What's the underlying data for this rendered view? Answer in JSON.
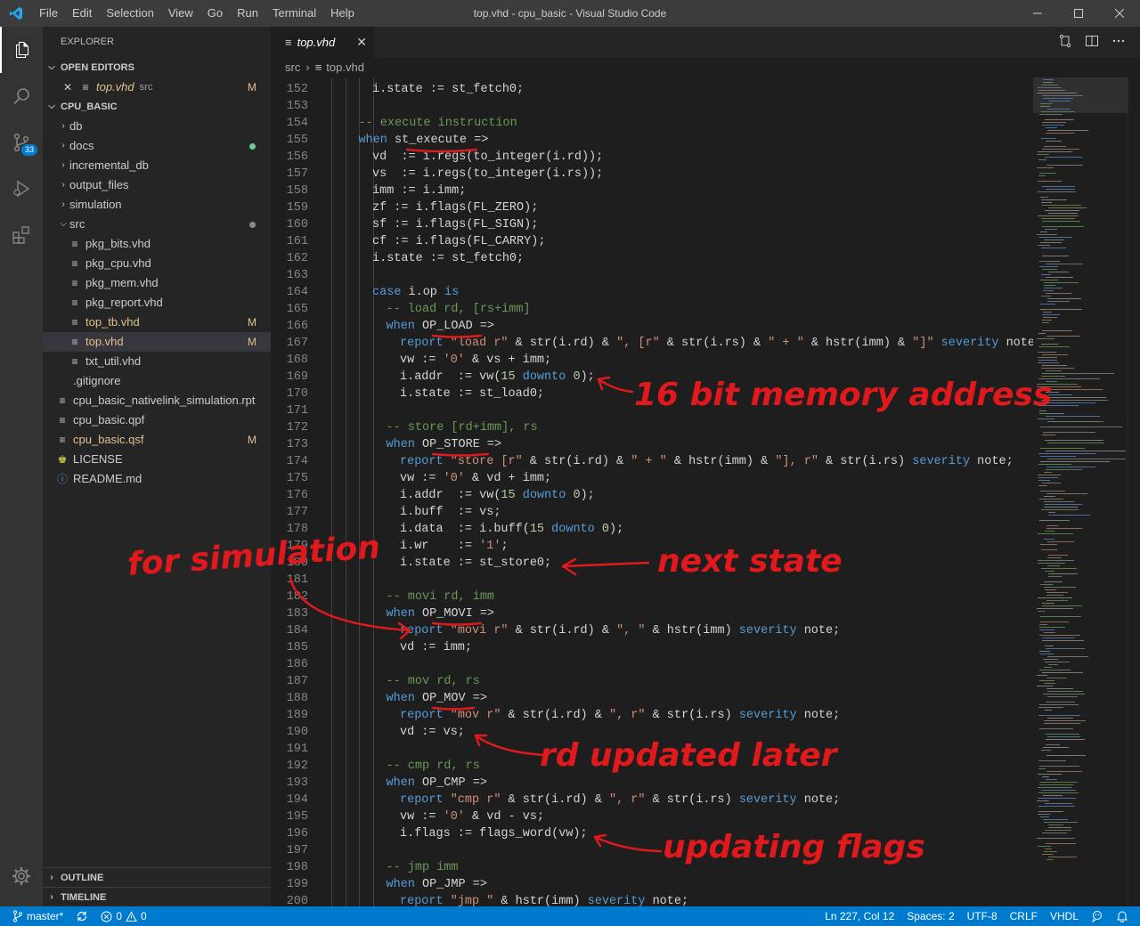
{
  "window": {
    "title": "top.vhd - cpu_basic - Visual Studio Code"
  },
  "menu": [
    "File",
    "Edit",
    "Selection",
    "View",
    "Go",
    "Run",
    "Terminal",
    "Help"
  ],
  "activity": {
    "scm_badge": "33"
  },
  "sidebar": {
    "header": "EXPLORER",
    "open_editors": {
      "title": "OPEN EDITORS",
      "items": [
        {
          "name": "top.vhd",
          "folder": "src",
          "status": "M"
        }
      ]
    },
    "project": {
      "title": "CPU_BASIC",
      "folders": [
        "db",
        "docs",
        "incremental_db",
        "output_files",
        "simulation",
        "src"
      ],
      "src_files": [
        {
          "name": "pkg_bits.vhd",
          "status": ""
        },
        {
          "name": "pkg_cpu.vhd",
          "status": ""
        },
        {
          "name": "pkg_mem.vhd",
          "status": ""
        },
        {
          "name": "pkg_report.vhd",
          "status": ""
        },
        {
          "name": "top_tb.vhd",
          "status": "M"
        },
        {
          "name": "top.vhd",
          "status": "M"
        },
        {
          "name": "txt_util.vhd",
          "status": ""
        }
      ],
      "root_files": [
        {
          "name": ".gitignore",
          "status": ""
        },
        {
          "name": "cpu_basic_nativelink_simulation.rpt",
          "status": ""
        },
        {
          "name": "cpu_basic.qpf",
          "status": ""
        },
        {
          "name": "cpu_basic.qsf",
          "status": "M"
        },
        {
          "name": "LICENSE",
          "status": ""
        },
        {
          "name": "README.md",
          "status": ""
        }
      ]
    },
    "outline": "OUTLINE",
    "timeline": "TIMELINE"
  },
  "editor": {
    "tab": "top.vhd",
    "breadcrumb": [
      "src",
      "top.vhd"
    ],
    "lines": [
      {
        "n": "152",
        "i": 2,
        "t": [
          [
            "",
            "i.state := st_fetch0;"
          ]
        ]
      },
      {
        "n": "153",
        "i": 0,
        "t": []
      },
      {
        "n": "154",
        "i": 1,
        "t": [
          [
            "c",
            "-- execute instruction"
          ]
        ]
      },
      {
        "n": "155",
        "i": 1,
        "t": [
          [
            "k",
            "when"
          ],
          [
            "",
            " st_execute =>"
          ]
        ]
      },
      {
        "n": "156",
        "i": 2,
        "t": [
          [
            "",
            "vd  := i.regs(to_integer(i.rd));"
          ]
        ]
      },
      {
        "n": "157",
        "i": 2,
        "t": [
          [
            "",
            "vs  := i.regs(to_integer(i.rs));"
          ]
        ]
      },
      {
        "n": "158",
        "i": 2,
        "t": [
          [
            "",
            "imm := i.imm;"
          ]
        ]
      },
      {
        "n": "159",
        "i": 2,
        "t": [
          [
            "",
            "zf := i.flags(FL_ZERO);"
          ]
        ]
      },
      {
        "n": "160",
        "i": 2,
        "t": [
          [
            "",
            "sf := i.flags(FL_SIGN);"
          ]
        ]
      },
      {
        "n": "161",
        "i": 2,
        "t": [
          [
            "",
            "cf := i.flags(FL_CARRY);"
          ]
        ]
      },
      {
        "n": "162",
        "i": 2,
        "t": [
          [
            "",
            "i.state := st_fetch0;"
          ]
        ]
      },
      {
        "n": "163",
        "i": 0,
        "t": []
      },
      {
        "n": "164",
        "i": 2,
        "t": [
          [
            "k",
            "case"
          ],
          [
            "",
            " i.op "
          ],
          [
            "k",
            "is"
          ]
        ]
      },
      {
        "n": "165",
        "i": 3,
        "t": [
          [
            "c",
            "-- load rd, [rs+imm]"
          ]
        ]
      },
      {
        "n": "166",
        "i": 3,
        "t": [
          [
            "k",
            "when"
          ],
          [
            "",
            " OP_LOAD =>"
          ]
        ]
      },
      {
        "n": "167",
        "i": 4,
        "t": [
          [
            "k",
            "report"
          ],
          [
            "",
            " "
          ],
          [
            "s",
            "\"load r\""
          ],
          [
            "",
            " & str(i.rd) & "
          ],
          [
            "s",
            "\", [r\""
          ],
          [
            "",
            " & str(i.rs) & "
          ],
          [
            "s",
            "\" + \""
          ],
          [
            "",
            " & hstr(imm) & "
          ],
          [
            "s",
            "\"]\""
          ],
          [
            "",
            " "
          ],
          [
            "k",
            "severity"
          ],
          [
            "",
            " note;"
          ]
        ]
      },
      {
        "n": "168",
        "i": 4,
        "t": [
          [
            "",
            "vw := "
          ],
          [
            "s",
            "'0'"
          ],
          [
            "",
            " & vs + imm;"
          ]
        ]
      },
      {
        "n": "169",
        "i": 4,
        "t": [
          [
            "",
            "i.addr  := vw("
          ],
          [
            "n",
            "15"
          ],
          [
            "",
            " "
          ],
          [
            "k",
            "downto"
          ],
          [
            "",
            " "
          ],
          [
            "n",
            "0"
          ],
          [
            "",
            ");"
          ]
        ]
      },
      {
        "n": "170",
        "i": 4,
        "t": [
          [
            "",
            "i.state := st_load0;"
          ]
        ]
      },
      {
        "n": "171",
        "i": 0,
        "t": []
      },
      {
        "n": "172",
        "i": 3,
        "t": [
          [
            "c",
            "-- store [rd+imm], rs"
          ]
        ]
      },
      {
        "n": "173",
        "i": 3,
        "t": [
          [
            "k",
            "when"
          ],
          [
            "",
            " OP_STORE =>"
          ]
        ]
      },
      {
        "n": "174",
        "i": 4,
        "t": [
          [
            "k",
            "report"
          ],
          [
            "",
            " "
          ],
          [
            "s",
            "\"store [r\""
          ],
          [
            "",
            " & str(i.rd) & "
          ],
          [
            "s",
            "\" + \""
          ],
          [
            "",
            " & hstr(imm) & "
          ],
          [
            "s",
            "\"], r\""
          ],
          [
            "",
            " & str(i.rs) "
          ],
          [
            "k",
            "severity"
          ],
          [
            "",
            " note;"
          ]
        ]
      },
      {
        "n": "175",
        "i": 4,
        "t": [
          [
            "",
            "vw := "
          ],
          [
            "s",
            "'0'"
          ],
          [
            "",
            " & vd + imm;"
          ]
        ]
      },
      {
        "n": "176",
        "i": 4,
        "t": [
          [
            "",
            "i.addr  := vw("
          ],
          [
            "n",
            "15"
          ],
          [
            "",
            " "
          ],
          [
            "k",
            "downto"
          ],
          [
            "",
            " "
          ],
          [
            "n",
            "0"
          ],
          [
            "",
            ");"
          ]
        ]
      },
      {
        "n": "177",
        "i": 4,
        "t": [
          [
            "",
            "i.buff  := vs;"
          ]
        ]
      },
      {
        "n": "178",
        "i": 4,
        "t": [
          [
            "",
            "i.data  := i.buff("
          ],
          [
            "n",
            "15"
          ],
          [
            "",
            " "
          ],
          [
            "k",
            "downto"
          ],
          [
            "",
            " "
          ],
          [
            "n",
            "0"
          ],
          [
            "",
            ");"
          ]
        ]
      },
      {
        "n": "179",
        "i": 4,
        "t": [
          [
            "",
            "i.wr    := "
          ],
          [
            "s",
            "'1'"
          ],
          [
            "",
            ";"
          ]
        ]
      },
      {
        "n": "180",
        "i": 4,
        "t": [
          [
            "",
            "i.state := st_store0;"
          ]
        ]
      },
      {
        "n": "181",
        "i": 0,
        "t": []
      },
      {
        "n": "182",
        "i": 3,
        "t": [
          [
            "c",
            "-- movi rd, imm"
          ]
        ]
      },
      {
        "n": "183",
        "i": 3,
        "t": [
          [
            "k",
            "when"
          ],
          [
            "",
            " OP_MOVI =>"
          ]
        ]
      },
      {
        "n": "184",
        "i": 4,
        "t": [
          [
            "k",
            "report"
          ],
          [
            "",
            " "
          ],
          [
            "s",
            "\"movi r\""
          ],
          [
            "",
            " & str(i.rd) & "
          ],
          [
            "s",
            "\", \""
          ],
          [
            "",
            " & hstr(imm) "
          ],
          [
            "k",
            "severity"
          ],
          [
            "",
            " note;"
          ]
        ]
      },
      {
        "n": "185",
        "i": 4,
        "t": [
          [
            "",
            "vd := imm;"
          ]
        ]
      },
      {
        "n": "186",
        "i": 0,
        "t": []
      },
      {
        "n": "187",
        "i": 3,
        "t": [
          [
            "c",
            "-- mov rd, rs"
          ]
        ]
      },
      {
        "n": "188",
        "i": 3,
        "t": [
          [
            "k",
            "when"
          ],
          [
            "",
            " OP_MOV =>"
          ]
        ]
      },
      {
        "n": "189",
        "i": 4,
        "t": [
          [
            "k",
            "report"
          ],
          [
            "",
            " "
          ],
          [
            "s",
            "\"mov r\""
          ],
          [
            "",
            " & str(i.rd) & "
          ],
          [
            "s",
            "\", r\""
          ],
          [
            "",
            " & str(i.rs) "
          ],
          [
            "k",
            "severity"
          ],
          [
            "",
            " note;"
          ]
        ]
      },
      {
        "n": "190",
        "i": 4,
        "t": [
          [
            "",
            "vd := vs;"
          ]
        ]
      },
      {
        "n": "191",
        "i": 0,
        "t": []
      },
      {
        "n": "192",
        "i": 3,
        "t": [
          [
            "c",
            "-- cmp rd, rs"
          ]
        ]
      },
      {
        "n": "193",
        "i": 3,
        "t": [
          [
            "k",
            "when"
          ],
          [
            "",
            " OP_CMP =>"
          ]
        ]
      },
      {
        "n": "194",
        "i": 4,
        "t": [
          [
            "k",
            "report"
          ],
          [
            "",
            " "
          ],
          [
            "s",
            "\"cmp r\""
          ],
          [
            "",
            " & str(i.rd) & "
          ],
          [
            "s",
            "\", r\""
          ],
          [
            "",
            " & str(i.rs) "
          ],
          [
            "k",
            "severity"
          ],
          [
            "",
            " note;"
          ]
        ]
      },
      {
        "n": "195",
        "i": 4,
        "t": [
          [
            "",
            "vw := "
          ],
          [
            "s",
            "'0'"
          ],
          [
            "",
            " & vd - vs;"
          ]
        ]
      },
      {
        "n": "196",
        "i": 4,
        "t": [
          [
            "",
            "i.flags := flags_word(vw);"
          ]
        ]
      },
      {
        "n": "197",
        "i": 0,
        "t": []
      },
      {
        "n": "198",
        "i": 3,
        "t": [
          [
            "c",
            "-- jmp imm"
          ]
        ]
      },
      {
        "n": "199",
        "i": 3,
        "t": [
          [
            "k",
            "when"
          ],
          [
            "",
            " OP_JMP =>"
          ]
        ]
      },
      {
        "n": "200",
        "i": 4,
        "t": [
          [
            "k",
            "report"
          ],
          [
            "",
            " "
          ],
          [
            "s",
            "\"jmp \""
          ],
          [
            "",
            " & hstr(imm) "
          ],
          [
            "k",
            "severity"
          ],
          [
            "",
            " note;"
          ]
        ]
      }
    ]
  },
  "annotations": {
    "addr": "16 bit memory address",
    "next": "next state",
    "sim": "for simulation",
    "rd": "rd updated later",
    "flags": "updating flags"
  },
  "status": {
    "branch": "master*",
    "errors": "0",
    "warnings": "0",
    "position": "Ln 227, Col 12",
    "spaces": "Spaces: 2",
    "encoding": "UTF-8",
    "eol": "CRLF",
    "language": "VHDL"
  },
  "colors": {
    "accent": "#007acc",
    "annotation": "#e0191d",
    "modified": "#e2c08d"
  }
}
